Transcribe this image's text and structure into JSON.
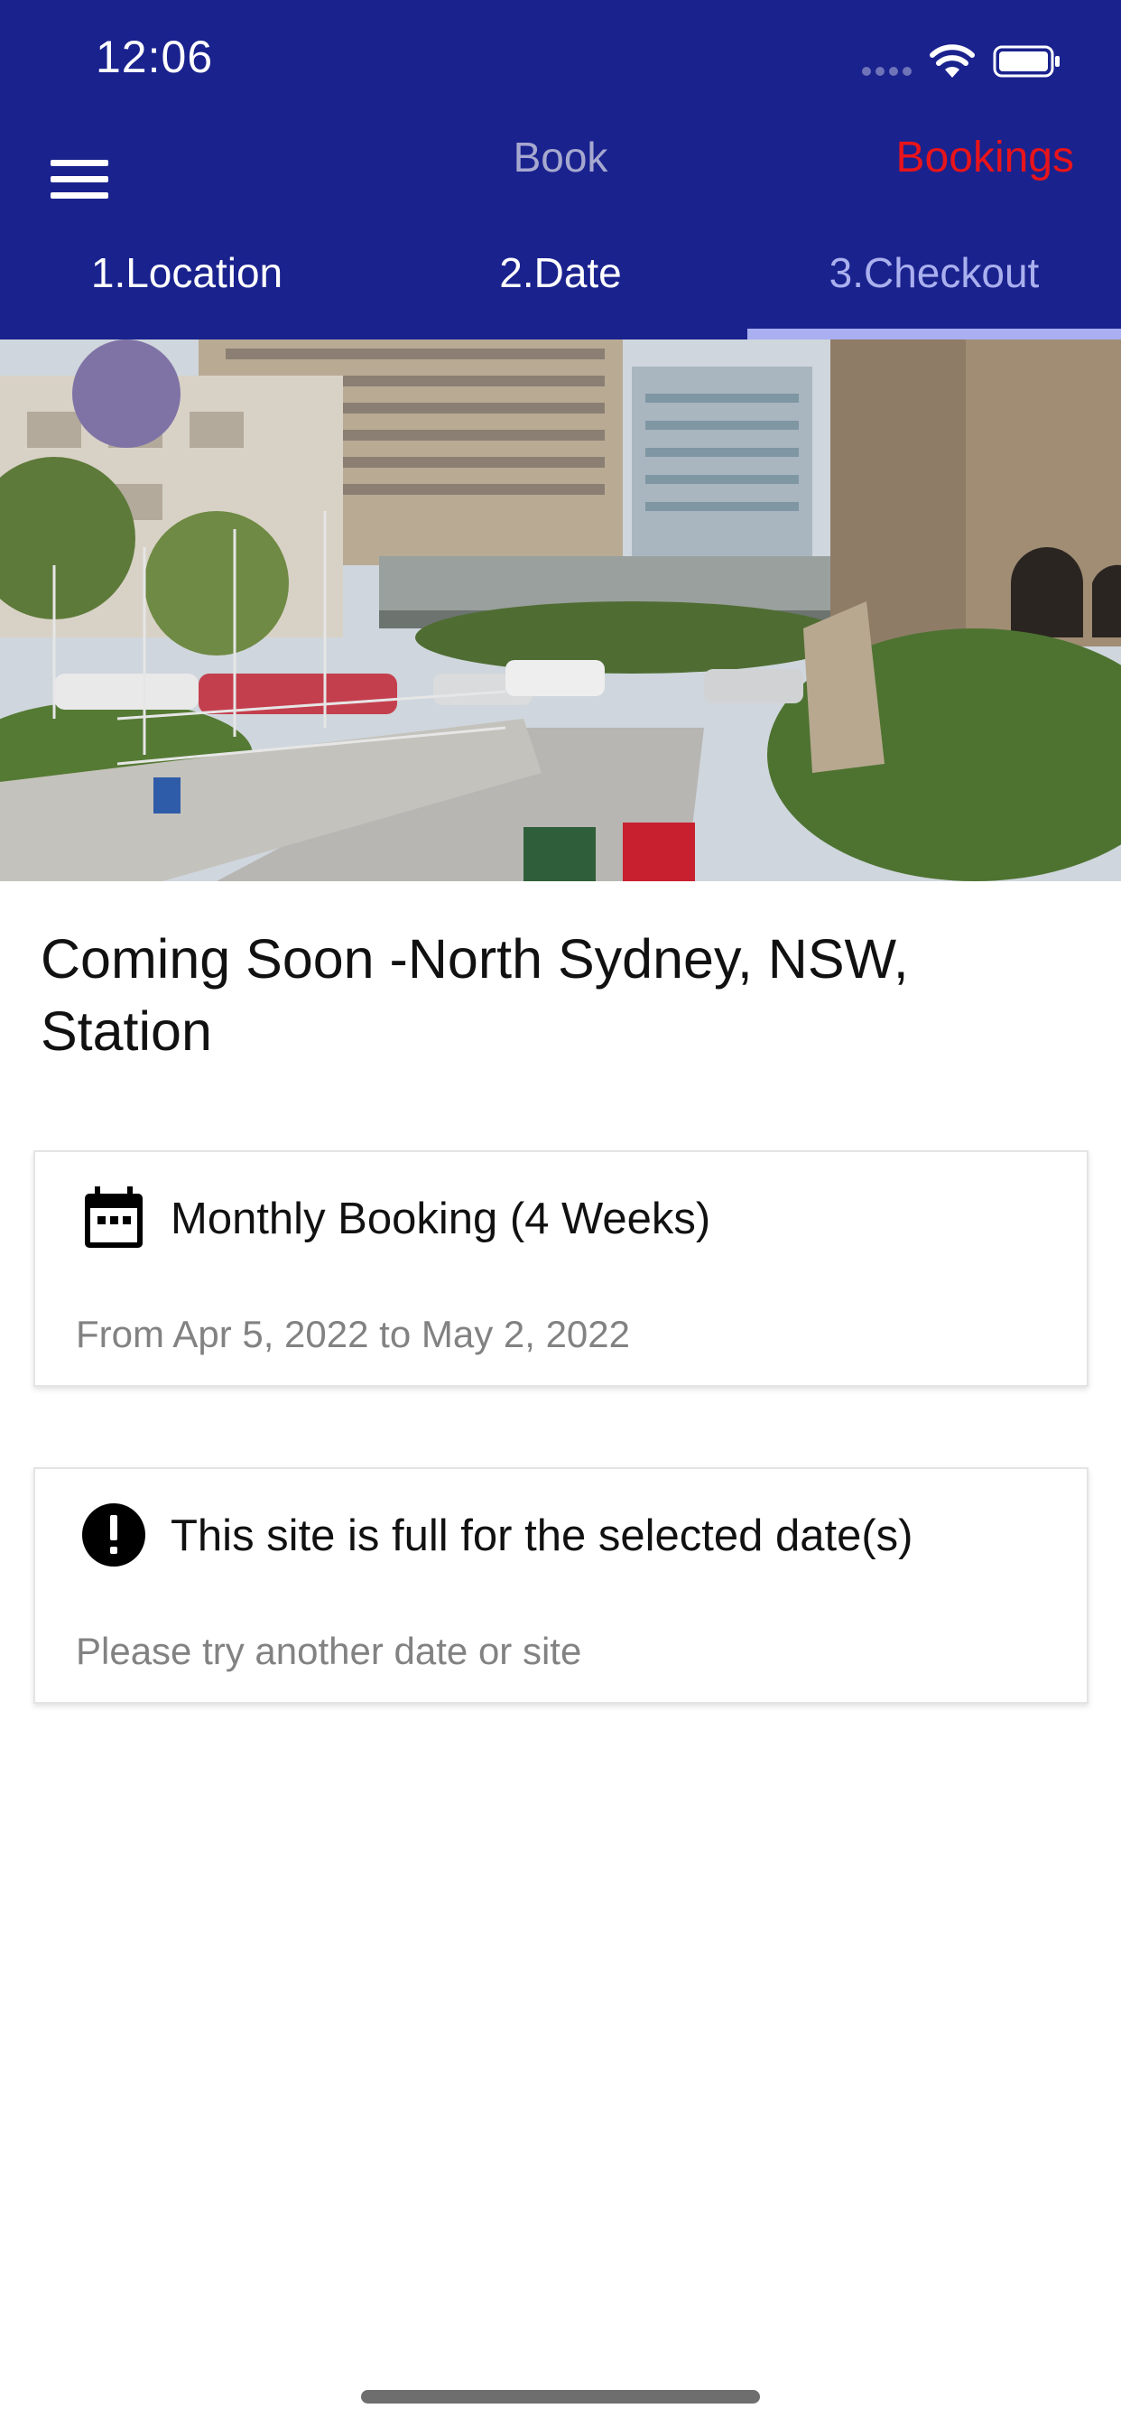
{
  "status_bar": {
    "time": "12:06"
  },
  "topbar": {
    "title": "Book",
    "bookings_label": "Bookings"
  },
  "tabs": [
    {
      "label": "1.Location",
      "active": false
    },
    {
      "label": "2.Date",
      "active": false
    },
    {
      "label": "3.Checkout",
      "active": true
    }
  ],
  "site": {
    "title": "Coming Soon -North Sydney, NSW, Station"
  },
  "booking_card": {
    "icon": "calendar-icon",
    "title": "Monthly Booking (4 Weeks)",
    "subtitle": "From Apr 5, 2022 to May 2, 2022"
  },
  "alert_card": {
    "icon": "alert-circle-icon",
    "title": "This site is full for the selected date(s)",
    "subtitle": "Please try another date or site"
  },
  "colors": {
    "header_bg": "#1a228e",
    "accent_red": "#e8141b",
    "active_tab": "#aab0ee",
    "muted_text": "#828282"
  }
}
